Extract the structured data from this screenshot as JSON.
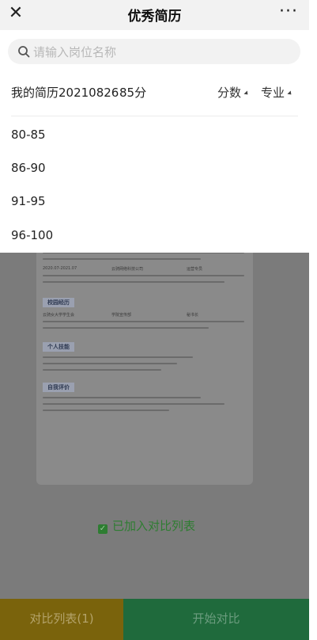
{
  "nav": {
    "title": "优秀简历",
    "close_icon": "close-icon",
    "more_label": "···"
  },
  "search": {
    "placeholder": "请输入岗位名称"
  },
  "resume": {
    "name": "我的简历20210826",
    "score": "85分"
  },
  "sort": {
    "score_label": "分数",
    "major_label": "专业"
  },
  "score_ranges": [
    "80-85",
    "86-90",
    "91-95",
    "96-100"
  ],
  "preview": {
    "section_campus": "校园经历",
    "section_skills": "个人技能",
    "section_eval": "自我评价",
    "job_period": "2020.07-2021.07",
    "company": "云骑网络科技公司",
    "position": "运营专员",
    "school_org": "云骑女大学学生会",
    "dept": "学院宣传部",
    "role": "秘书长"
  },
  "status": {
    "added_label": "已加入对比列表"
  },
  "footer": {
    "compare_list_label": "对比列表(1)",
    "start_label": "开始对比"
  },
  "colors": {
    "accent_green": "#2e7d32",
    "gold": "#7a630c",
    "dark_green": "#1f6a3c"
  }
}
